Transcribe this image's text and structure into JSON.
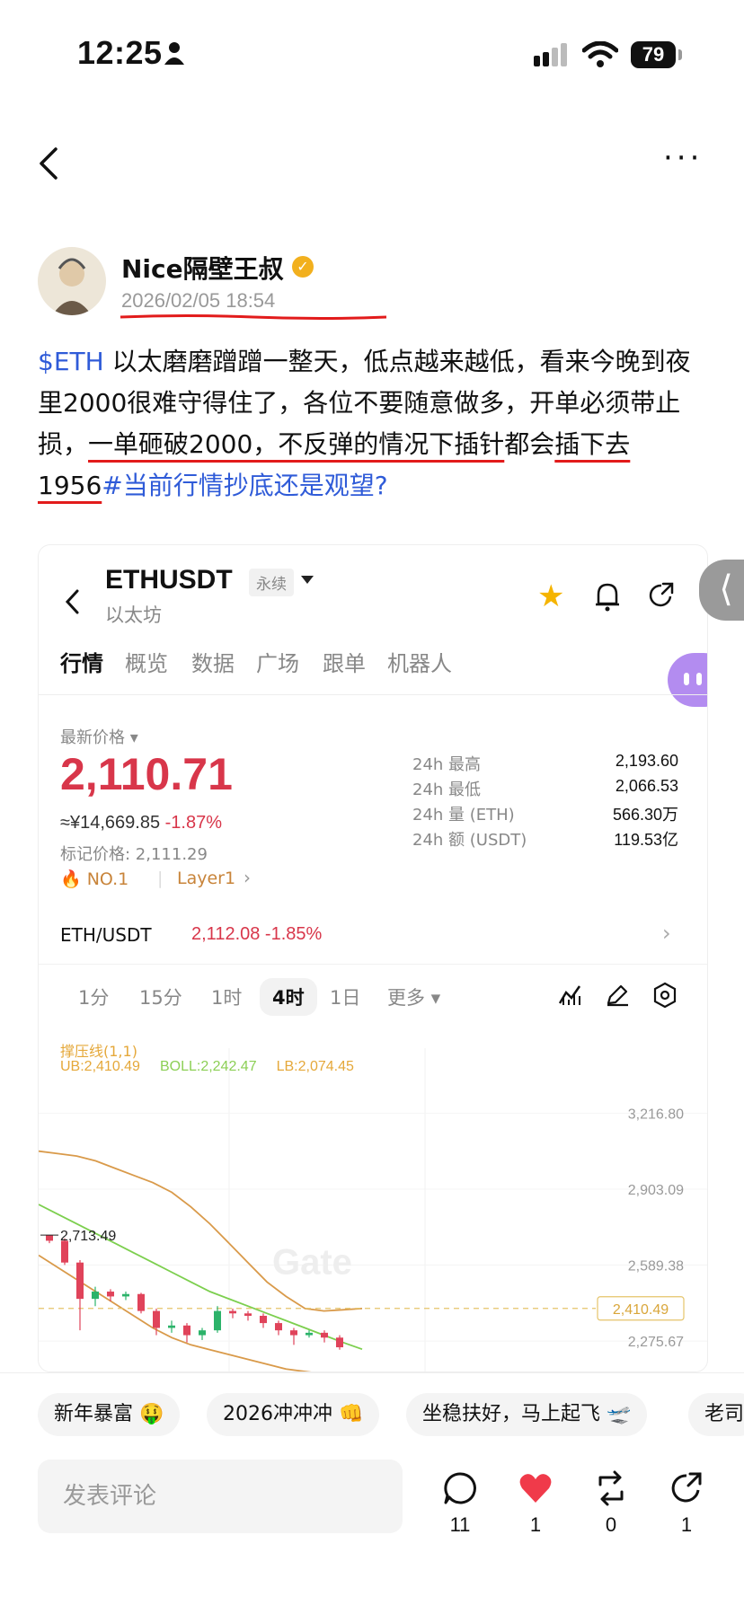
{
  "status_bar": {
    "time": "12:25",
    "battery": "79"
  },
  "author": {
    "name": "Nice隔壁王叔",
    "time": "2026/02/05 18:54"
  },
  "post": {
    "tag_coin": "$ETH",
    "text_1": " 以太磨磨蹭蹭一整天，低点越来越低，看来今晚到夜里2000很难守得住了，各位不要随意做多，开单必须带止损，",
    "text_underlined_1": "一单砸破2000，不反弹的情况下插针",
    "text_2": "都会",
    "text_underlined_2": "插下去1956",
    "topic": "#当前行情抄底还是观望?"
  },
  "embed": {
    "pair": "ETHUSDT",
    "perp_badge": "永续",
    "subtitle": "以太坊",
    "tabs": [
      "行情",
      "概览",
      "数据",
      "广场",
      "跟单",
      "机器人"
    ],
    "latest_price_label": "最新价格 ▾",
    "price": "2,110.71",
    "cny": "≈¥14,669.85",
    "cny_change": "-1.87%",
    "mark_price": "标记价格: 2,111.29",
    "rank": "NO.1",
    "layer": "Layer1",
    "stats": [
      {
        "label": "24h  最高",
        "value": "2,193.60"
      },
      {
        "label": "24h  最低",
        "value": "2,066.53"
      },
      {
        "label": "24h  量 (ETH)",
        "value": "566.30万"
      },
      {
        "label": "24h  额 (USDT)",
        "value": "119.53亿"
      }
    ],
    "spot_pair": "ETH/USDT",
    "spot_value": "2,112.08  -1.85%",
    "timeframes": [
      "1分",
      "15分",
      "1时",
      "4时",
      "1日",
      "更多 ▾"
    ],
    "indicator_name": "撑压线(1,1)",
    "ub": "UB:2,410.49",
    "boll": "BOLL:2,242.47",
    "lb": "LB:2,074.45",
    "watermark": "Gate"
  },
  "chart_data": {
    "type": "line",
    "title": "",
    "y_ticks": [
      "3,216.80",
      "2,903.09",
      "2,589.38",
      "2,275.67"
    ],
    "high_marker": "2,713.49",
    "current_line": "2,410.49",
    "ylim": [
      2150,
      3300
    ],
    "series": [
      {
        "name": "UB",
        "values": [
          3060,
          3050,
          3040,
          3020,
          2990,
          2960,
          2930,
          2890,
          2830,
          2760,
          2680,
          2600,
          2520,
          2460,
          2410,
          2400,
          2405,
          2410
        ]
      },
      {
        "name": "BOLL",
        "values": [
          2840,
          2800,
          2760,
          2720,
          2680,
          2640,
          2600,
          2560,
          2520,
          2480,
          2450,
          2420,
          2390,
          2360,
          2330,
          2300,
          2270,
          2242
        ]
      },
      {
        "name": "LB",
        "values": [
          2630,
          2580,
          2530,
          2480,
          2430,
          2380,
          2330,
          2290,
          2260,
          2240,
          2220,
          2200,
          2180,
          2160,
          2150,
          2140,
          2130,
          2074
        ]
      }
    ],
    "candles": [
      {
        "o": 2713,
        "c": 2690,
        "h": 2713,
        "l": 2680
      },
      {
        "o": 2690,
        "c": 2600,
        "h": 2700,
        "l": 2590
      },
      {
        "o": 2600,
        "c": 2450,
        "h": 2610,
        "l": 2320
      },
      {
        "o": 2450,
        "c": 2480,
        "h": 2500,
        "l": 2420
      },
      {
        "o": 2480,
        "c": 2460,
        "h": 2490,
        "l": 2440
      },
      {
        "o": 2460,
        "c": 2470,
        "h": 2480,
        "l": 2445
      },
      {
        "o": 2470,
        "c": 2400,
        "h": 2475,
        "l": 2390
      },
      {
        "o": 2400,
        "c": 2330,
        "h": 2410,
        "l": 2300
      },
      {
        "o": 2330,
        "c": 2340,
        "h": 2360,
        "l": 2310
      },
      {
        "o": 2340,
        "c": 2300,
        "h": 2350,
        "l": 2270
      },
      {
        "o": 2300,
        "c": 2320,
        "h": 2330,
        "l": 2280
      },
      {
        "o": 2320,
        "c": 2400,
        "h": 2420,
        "l": 2310
      },
      {
        "o": 2400,
        "c": 2390,
        "h": 2410,
        "l": 2370
      },
      {
        "o": 2390,
        "c": 2380,
        "h": 2400,
        "l": 2360
      },
      {
        "o": 2380,
        "c": 2350,
        "h": 2390,
        "l": 2330
      },
      {
        "o": 2350,
        "c": 2320,
        "h": 2360,
        "l": 2300
      },
      {
        "o": 2320,
        "c": 2300,
        "h": 2330,
        "l": 2260
      },
      {
        "o": 2300,
        "c": 2310,
        "h": 2320,
        "l": 2290
      },
      {
        "o": 2310,
        "c": 2290,
        "h": 2320,
        "l": 2270
      },
      {
        "o": 2290,
        "c": 2250,
        "h": 2300,
        "l": 2240
      }
    ]
  },
  "chips": [
    "新年暴富 🤑",
    "2026冲冲冲 👊",
    "坐稳扶好，马上起飞 🛫",
    "老司"
  ],
  "comment_placeholder": "发表评论",
  "actions": {
    "comments": "11",
    "likes": "1",
    "reposts": "0",
    "shares": "1"
  },
  "colors": {
    "accent_red": "#d8364a",
    "link_blue": "#2f5bd8",
    "underline_red": "#e21b1b",
    "boll_orange": "#e5a83a",
    "boll_green": "#8ccf55"
  }
}
